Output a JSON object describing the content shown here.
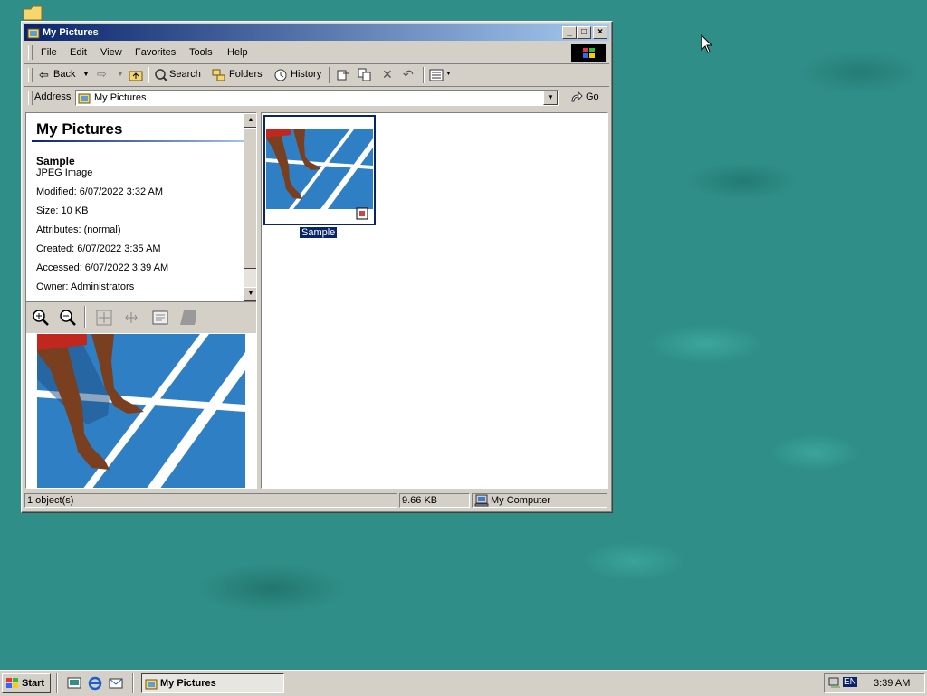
{
  "window": {
    "title": "My Pictures",
    "menu": [
      "File",
      "Edit",
      "View",
      "Favorites",
      "Tools",
      "Help"
    ],
    "toolbar": {
      "back_label": "Back",
      "search_label": "Search",
      "folders_label": "Folders",
      "history_label": "History"
    },
    "address": {
      "label": "Address",
      "value": "My Pictures",
      "go_label": "Go"
    }
  },
  "info_pane": {
    "title": "My Pictures",
    "file_name": "Sample",
    "file_type": "JPEG Image",
    "modified": "Modified: 6/07/2022 3:32 AM",
    "size": "Size: 10 KB",
    "attributes": "Attributes: (normal)",
    "created": "Created: 6/07/2022 3:35 AM",
    "accessed": "Accessed: 6/07/2022 3:39 AM",
    "owner": "Owner: Administrators"
  },
  "file_view": {
    "items": [
      {
        "label": "Sample",
        "selected": true
      }
    ]
  },
  "statusbar": {
    "objects": "1 object(s)",
    "size": "9.66 KB",
    "zone": "My Computer"
  },
  "taskbar": {
    "start_label": "Start",
    "task_label": "My Pictures",
    "lang": "EN",
    "clock": "3:39 AM"
  },
  "colors": {
    "title_active": "#0a246a",
    "desktop": "#2f8f88",
    "selection": "#0a246a"
  }
}
